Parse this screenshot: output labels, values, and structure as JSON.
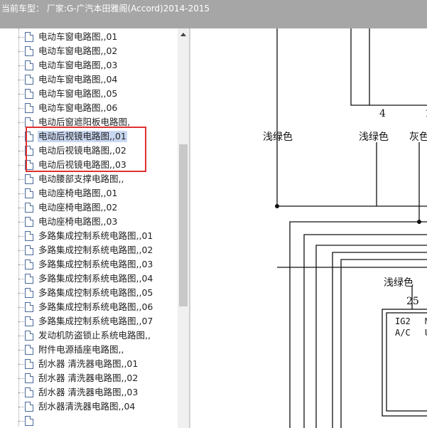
{
  "title_bar": {
    "text": "当前车型：  厂家:G-广汽本田雅阁(Accord)2014-2015"
  },
  "tree": {
    "items": [
      {
        "label": "电动车窗电路图,,01",
        "selected": false
      },
      {
        "label": "电动车窗电路图,,02",
        "selected": false
      },
      {
        "label": "电动车窗电路图,,03",
        "selected": false
      },
      {
        "label": "电动车窗电路图,,04",
        "selected": false
      },
      {
        "label": "电动车窗电路图,,05",
        "selected": false
      },
      {
        "label": "电动车窗电路图,,06",
        "selected": false
      },
      {
        "label": "电动后窗遮阳板电路图,",
        "selected": false
      },
      {
        "label": "电动后视镜电路图,,01",
        "selected": true
      },
      {
        "label": "电动后视镜电路图,,02",
        "selected": false
      },
      {
        "label": "电动后视镜电路图,,03",
        "selected": false
      },
      {
        "label": "电动腰部支撑电路图,,",
        "selected": false
      },
      {
        "label": "电动座椅电路图,,01",
        "selected": false
      },
      {
        "label": "电动座椅电路图,,02",
        "selected": false
      },
      {
        "label": "电动座椅电路图,,03",
        "selected": false
      },
      {
        "label": "多路集成控制系统电路图,,01",
        "selected": false
      },
      {
        "label": "多路集成控制系统电路图,,02",
        "selected": false
      },
      {
        "label": "多路集成控制系统电路图,,03",
        "selected": false
      },
      {
        "label": "多路集成控制系统电路图,,04",
        "selected": false
      },
      {
        "label": "多路集成控制系统电路图,,05",
        "selected": false
      },
      {
        "label": "多路集成控制系统电路图,,06",
        "selected": false
      },
      {
        "label": "多路集成控制系统电路图,,07",
        "selected": false
      },
      {
        "label": "发动机防盗锁止系统电路图,,",
        "selected": false
      },
      {
        "label": "附件电源插座电路图,,",
        "selected": false
      },
      {
        "label": "刮水器 清洗器电路图,,01",
        "selected": false
      },
      {
        "label": "刮水器 清洗器电路图,,02",
        "selected": false
      },
      {
        "label": "刮水器 清洗器电路图,,03",
        "selected": false
      },
      {
        "label": "刮水器清洗器电路图,,04",
        "selected": false
      },
      {
        "label": "",
        "selected": false
      }
    ]
  },
  "diagram": {
    "pin_4": "4",
    "pin_1_partial": "1",
    "wire_label_1": "浅绿色",
    "wire_label_2": "浅绿色",
    "wire_label_3": "灰色",
    "wire_label_4": "浅绿色",
    "pin_25": "25",
    "box_line1": "IG2",
    "box_line2": "A/C",
    "box_line1_partial": "M",
    "box_line2_partial": "U"
  },
  "colors": {
    "highlight_box": "#e03030",
    "selection": "#c9d7f1",
    "title_bar": "#a6a6a6"
  }
}
